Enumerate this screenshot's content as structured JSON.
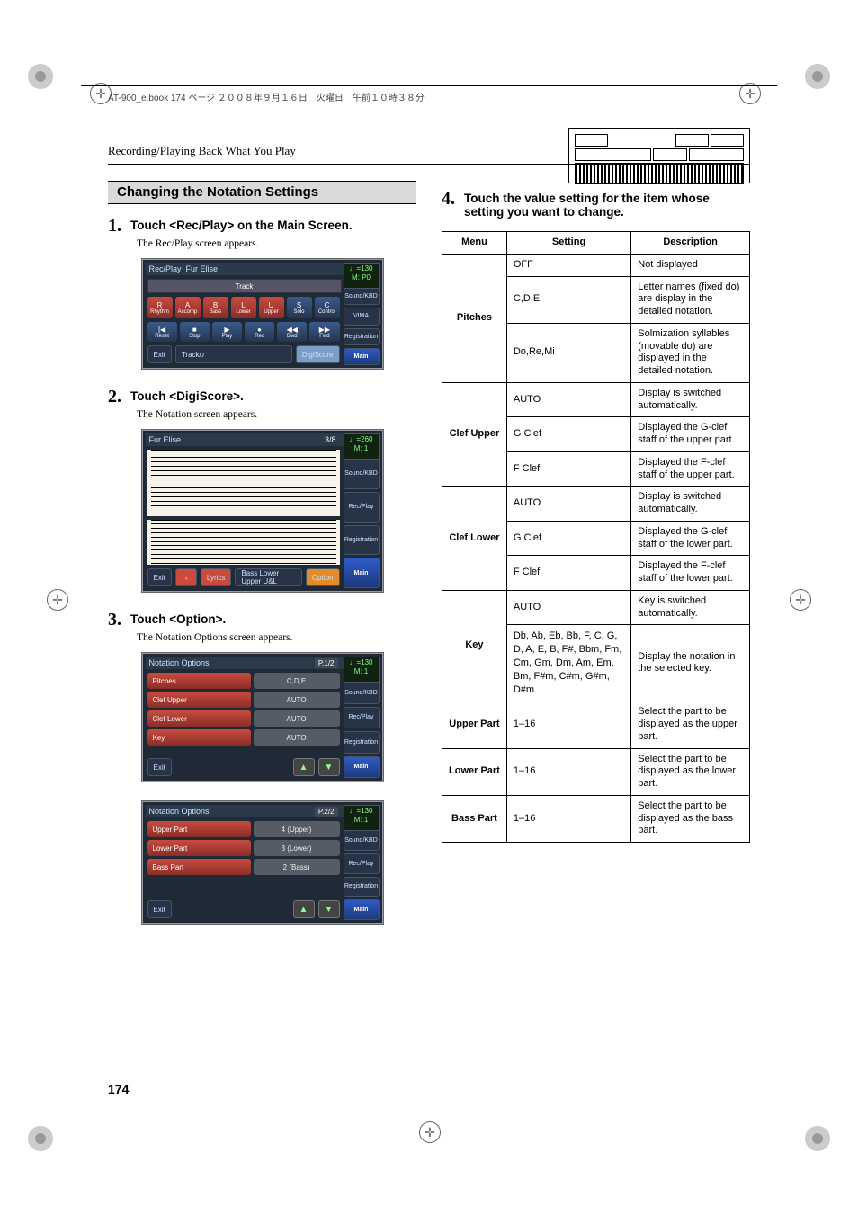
{
  "header_note": "AT-900_e.book  174 ページ  ２００８年９月１６日　火曜日　午前１０時３８分",
  "running_head": "Recording/Playing Back What You Play",
  "page_number": "174",
  "section_title": "Changing the Notation Settings",
  "steps": {
    "s1": {
      "num": "1.",
      "head": "Touch <Rec/Play> on the Main Screen.",
      "sub": "The Rec/Play screen appears."
    },
    "s2": {
      "num": "2.",
      "head": "Touch <DigiScore>.",
      "sub": "The Notation screen appears."
    },
    "s3": {
      "num": "3.",
      "head": "Touch <Option>.",
      "sub": "The Notation Options screen appears."
    },
    "s4": {
      "num": "4.",
      "head": "Touch the value setting for the item whose setting you want to change."
    }
  },
  "ui1": {
    "title": "Rec/Play",
    "song": "Fur Elise",
    "tempo": "♩=130",
    "meas": "M:   P0",
    "trackbar": "Track",
    "tiles": [
      "R",
      "A",
      "B",
      "L",
      "U",
      "S",
      "C"
    ],
    "tiles_sub": [
      "Rhythm",
      "Accomp",
      "Bass",
      "Lower",
      "Upper",
      "Solo",
      "Control"
    ],
    "transport": [
      "|◀",
      "■",
      "▶",
      "●",
      "◀◀",
      "▶▶"
    ],
    "transport_sub": [
      "Reset",
      "Stop",
      "Play",
      "Rec",
      "Bwd",
      "Fwd"
    ],
    "footer": {
      "exit": "Exit",
      "track": "Track/♪",
      "digi": "DigiScore"
    },
    "side": [
      "Sound/KBD",
      "VIMA",
      "Registration",
      "Main"
    ]
  },
  "ui2": {
    "title": "Fur Elise",
    "counter": "3/8",
    "tempo": "♩=260",
    "meas": "M:     1",
    "footer": {
      "exit": "Exit",
      "lyrics": "Lyrics",
      "parts": "Bass  Lower Upper  U&L",
      "option": "Option"
    },
    "side": [
      "Sound/KBD",
      "Rec/Play",
      "Registration",
      "Main"
    ]
  },
  "ui3": {
    "title": "Notation Options",
    "page": "P.1/2",
    "tempo": "♩=130",
    "meas": "M:     1",
    "rows": [
      {
        "label": "Pitches",
        "val": "C,D,E"
      },
      {
        "label": "Clef Upper",
        "val": "AUTO"
      },
      {
        "label": "Clef Lower",
        "val": "AUTO"
      },
      {
        "label": "Key",
        "val": "AUTO"
      }
    ],
    "exit": "Exit",
    "side": [
      "Sound/KBD",
      "Rec/Play",
      "Registration",
      "Main"
    ]
  },
  "ui4": {
    "title": "Notation Options",
    "page": "P.2/2",
    "tempo": "♩=130",
    "meas": "M:     1",
    "rows": [
      {
        "label": "Upper Part",
        "val": "4 (Upper)"
      },
      {
        "label": "Lower Part",
        "val": "3 (Lower)"
      },
      {
        "label": "Bass Part",
        "val": "2 (Bass)"
      }
    ],
    "exit": "Exit",
    "side": [
      "Sound/KBD",
      "Rec/Play",
      "Registration",
      "Main"
    ]
  },
  "table": {
    "head": {
      "menu": "Menu",
      "setting": "Setting",
      "desc": "Description"
    },
    "groups": [
      {
        "menu": "Pitches",
        "rows": [
          {
            "setting": "OFF",
            "desc": "Not displayed"
          },
          {
            "setting": "C,D,E",
            "desc": "Letter names (fixed do) are display in the detailed notation."
          },
          {
            "setting": "Do,Re,Mi",
            "desc": "Solmization syllables (movable do) are displayed in the detailed notation."
          }
        ]
      },
      {
        "menu": "Clef Upper",
        "rows": [
          {
            "setting": "AUTO",
            "desc": "Display is switched automatically."
          },
          {
            "setting": "G Clef",
            "desc": "Displayed the G-clef staff of the upper part."
          },
          {
            "setting": "F Clef",
            "desc": "Displayed the F-clef staff of the upper part."
          }
        ]
      },
      {
        "menu": "Clef Lower",
        "rows": [
          {
            "setting": "AUTO",
            "desc": "Display is switched automatically."
          },
          {
            "setting": "G Clef",
            "desc": "Displayed the G-clef staff of the lower part."
          },
          {
            "setting": "F Clef",
            "desc": "Displayed the F-clef staff of the lower part."
          }
        ]
      },
      {
        "menu": "Key",
        "rows": [
          {
            "setting": "AUTO",
            "desc": "Key is switched automatically."
          },
          {
            "setting": "Db, Ab, Eb, Bb, F, C, G, D, A, E, B, F#, Bbm, Fm, Cm, Gm, Dm, Am, Em, Bm, F#m, C#m, G#m, D#m",
            "desc": "Display the notation in the selected key."
          }
        ]
      },
      {
        "menu": "Upper Part",
        "rows": [
          {
            "setting": "1–16",
            "desc": "Select the part to be displayed as the upper part."
          }
        ]
      },
      {
        "menu": "Lower Part",
        "rows": [
          {
            "setting": "1–16",
            "desc": "Select the part to be displayed as the lower part."
          }
        ]
      },
      {
        "menu": "Bass Part",
        "rows": [
          {
            "setting": "1–16",
            "desc": "Select the part to be displayed as the bass part."
          }
        ]
      }
    ]
  }
}
